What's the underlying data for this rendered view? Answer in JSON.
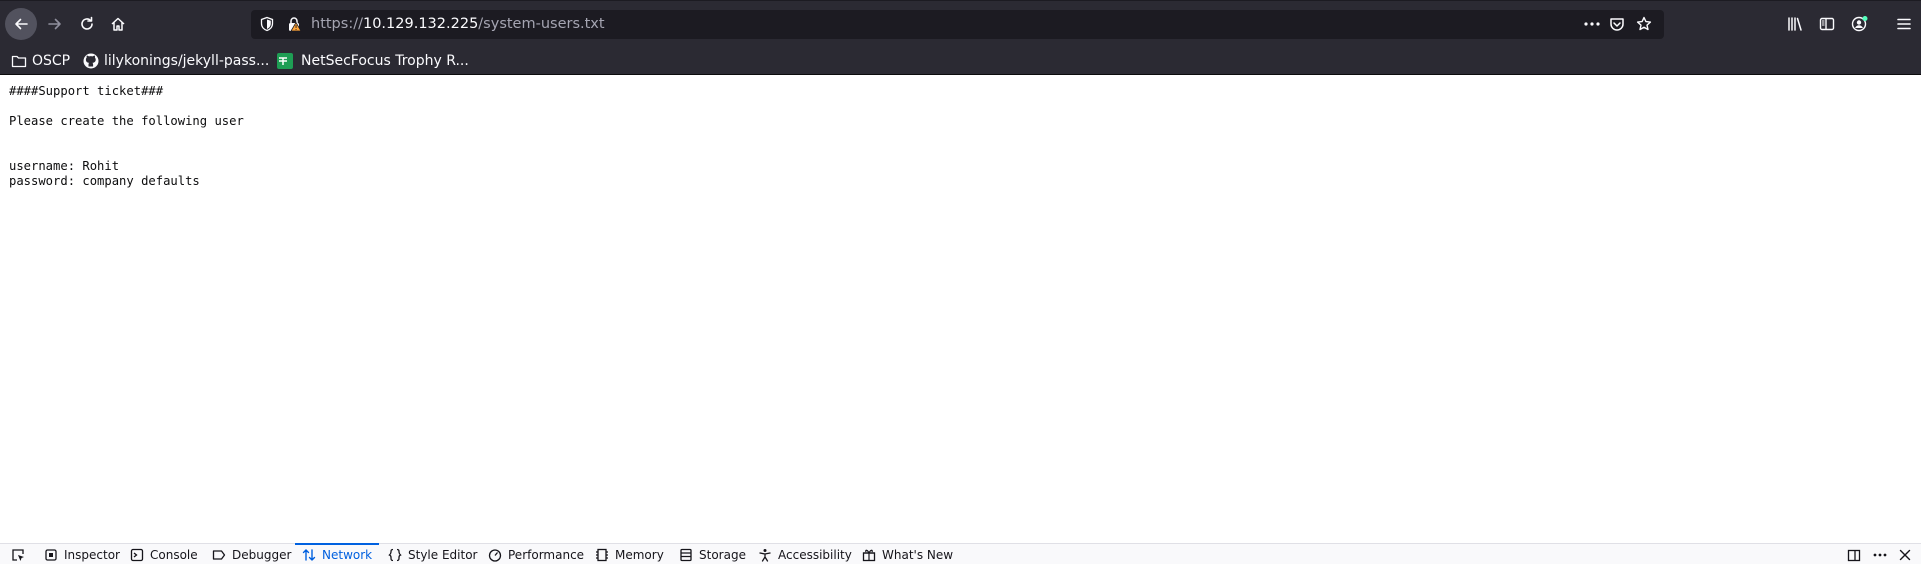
{
  "url": {
    "scheme": "https://",
    "host": "10.129.132.225",
    "path": "/system-users.txt"
  },
  "bookmarks": [
    {
      "label": "OSCP",
      "icon": "folder-icon"
    },
    {
      "label": "lilykonings/jekyll-pass...",
      "icon": "github-icon"
    },
    {
      "label": "NetSecFocus Trophy R...",
      "icon": "sheets-icon"
    }
  ],
  "document": {
    "text": "####Support ticket###\n\nPlease create the following user\n\n\nusername: Rohit\npassword: company defaults"
  },
  "devtools": {
    "tabs": [
      {
        "label": "Inspector",
        "icon": "inspector-icon"
      },
      {
        "label": "Console",
        "icon": "console-icon"
      },
      {
        "label": "Debugger",
        "icon": "debugger-icon"
      },
      {
        "label": "Network",
        "icon": "network-icon",
        "active": true
      },
      {
        "label": "Style Editor",
        "icon": "style-editor-icon"
      },
      {
        "label": "Performance",
        "icon": "performance-icon"
      },
      {
        "label": "Memory",
        "icon": "memory-icon"
      },
      {
        "label": "Storage",
        "icon": "storage-icon"
      },
      {
        "label": "Accessibility",
        "icon": "accessibility-icon"
      },
      {
        "label": "What's New",
        "icon": "whats-new-icon"
      }
    ]
  },
  "colors": {
    "toolbar_bg": "#2b2a33",
    "urlbar_bg": "#1c1b22",
    "active_tab": "#0060df",
    "lock_warning": "#ffa436"
  }
}
